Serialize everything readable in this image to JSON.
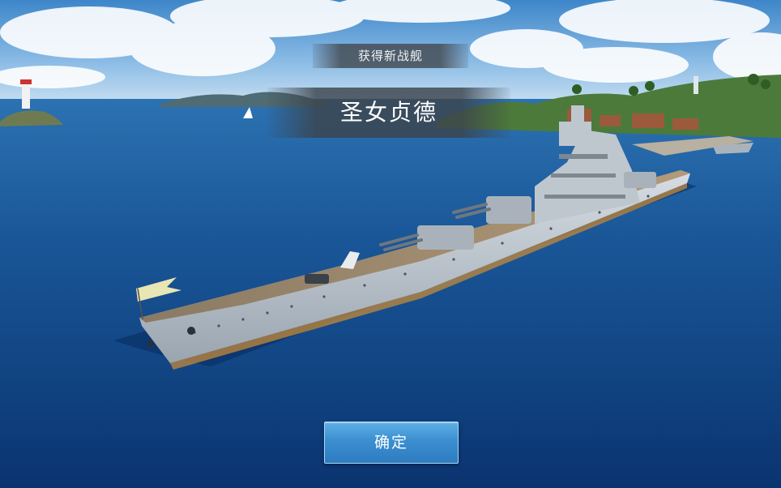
{
  "popup": {
    "header_label": "获得新战舰",
    "ship_name": "圣女贞德"
  },
  "actions": {
    "confirm_label": "确定"
  },
  "colors": {
    "sea": "#0d3d78",
    "sky": "#6fa6d8",
    "button": "#3b8fd0"
  }
}
